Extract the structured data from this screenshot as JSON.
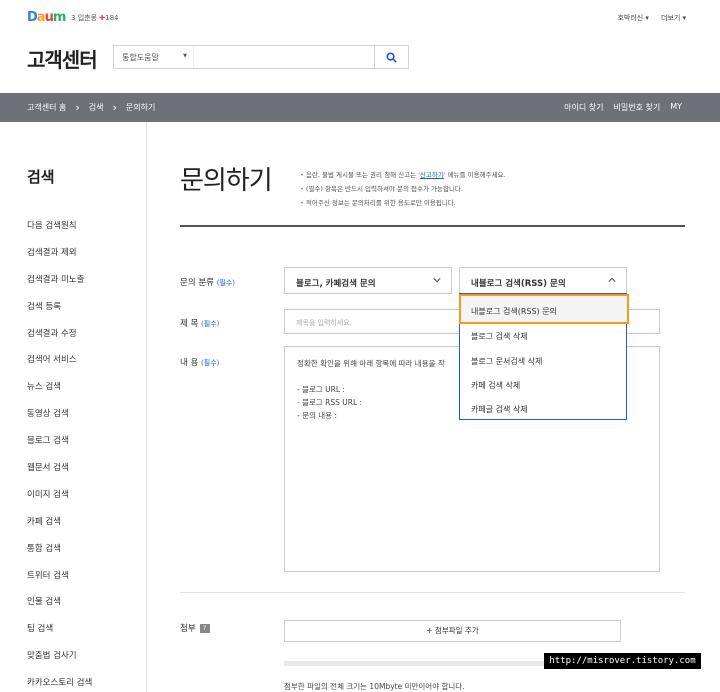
{
  "top": {
    "logo": [
      "D",
      "a",
      "u",
      "m"
    ],
    "weather_day": "3",
    "weather_text": "입춘몽",
    "weather_temp": "184",
    "links": [
      "호박러신 ▾",
      "더보기 ▾"
    ]
  },
  "header": {
    "title": "고객센터",
    "search_scope": "통합도움말",
    "search_placeholder": ""
  },
  "nav": {
    "crumbs": [
      "고객센터 홈",
      "검색",
      "문의하기"
    ],
    "right": [
      "아이디 찾기",
      "비밀번호 찾기",
      "MY"
    ]
  },
  "sidebar": {
    "title": "검색",
    "items": [
      "다음 검색원칙",
      "검색결과 제외",
      "검색결과 미노출",
      "검색 등록",
      "검색결과 수정",
      "검색어 서비스",
      "뉴스 검색",
      "동영상 검색",
      "블로그 검색",
      "웹문서 검색",
      "이미지 검색",
      "카페 검색",
      "통합 검색",
      "트위터 검색",
      "인물 검색",
      "팁 검색",
      "맞춤법 검사기",
      "카카오스토리 검색"
    ]
  },
  "main": {
    "title": "문의하기",
    "notices": {
      "n1_pre": "음란, 불법 게시물 또는 권리 침해 신고는 '",
      "n1_link": "신고하기",
      "n1_post": "' 메뉴를 이용해주세요.",
      "n2": "(필수) 항목은 반드시 입력하셔야 문의 접수가 가능합니다.",
      "n3": "적어주신 정보는 문의처리를 위한 용도로만 이용됩니다."
    },
    "required_tag": "(필수)",
    "category_label": "문의 분류",
    "category_main": "블로그, 카페검색 문의",
    "category_sub": "내블로그 검색(RSS) 문의",
    "title_label": "제 목",
    "title_placeholder": "제목을 입력하세요.",
    "content_label": "내 용",
    "content_lines": {
      "l1": "정확한 확인을 위해 아래 항목에 따라 내용을 작",
      "l2": "- 블로그 URL :",
      "l3": "- 블로그 RSS URL :",
      "l4": "- 문의 내용 :"
    },
    "attach_label": "첨부",
    "attach_help": "?",
    "attach_button": "+ 첨부파일 추가",
    "attach_progress": 0.0,
    "attach_note": "첨부한 파일의 전체 크기는 10Mbyte 미만이어야 합니다."
  },
  "dropdown": {
    "options": [
      "내블로그 검색(RSS) 문의",
      "블로그 검색 삭제",
      "블로그 문서검색 삭제",
      "카페 검색 삭제",
      "카페글 검색 삭제"
    ],
    "highlighted": 0
  },
  "watermark": "http://misrover.tistory.com",
  "colors": {
    "accent": "#1a5fd0",
    "highlight": "#f39a1e",
    "navbar": "#6e7178"
  }
}
